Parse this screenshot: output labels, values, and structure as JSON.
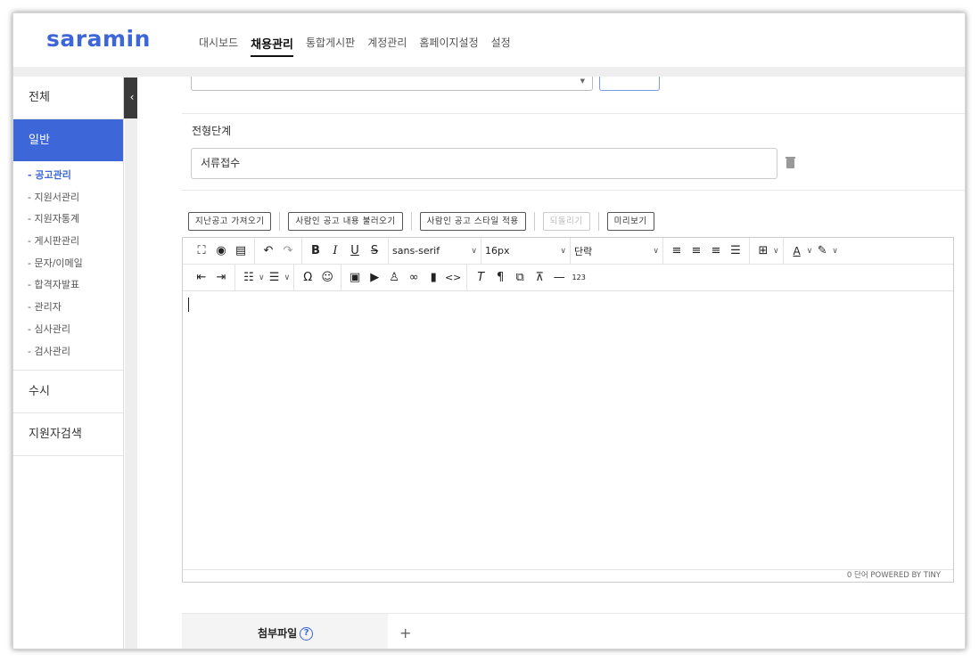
{
  "logo": "saramin",
  "nav": [
    "대시보드",
    "채용관리",
    "통합게시판",
    "계정관리",
    "홈페이지설정",
    "설정"
  ],
  "nav_active": 1,
  "sidebar": {
    "top": "전체",
    "active": "일반",
    "sub": [
      "- 공고관리",
      "- 지원서관리",
      "- 지원자통계",
      "- 게시판관리",
      "- 문자/이메일",
      "- 합격자발표",
      "- 관리자",
      "- 심사관리",
      "- 검사관리"
    ],
    "items": [
      "수시",
      "지원자검색"
    ],
    "collapse_glyph": "‹"
  },
  "form": {
    "stage_label": "전형단계",
    "stage_value": "서류접수"
  },
  "editor_buttons": [
    "지난공고 가져오기",
    "사람인 공고 내용 불러오기",
    "사람인 공고 스타일 적용",
    "되돌리기",
    "미리보기"
  ],
  "editor": {
    "font": "sans-serif",
    "size": "16px",
    "block": "단락",
    "status": "0 단어  POWERED BY TINY"
  },
  "attachment": {
    "label": "첨부파일",
    "help": "?",
    "add": "+"
  }
}
